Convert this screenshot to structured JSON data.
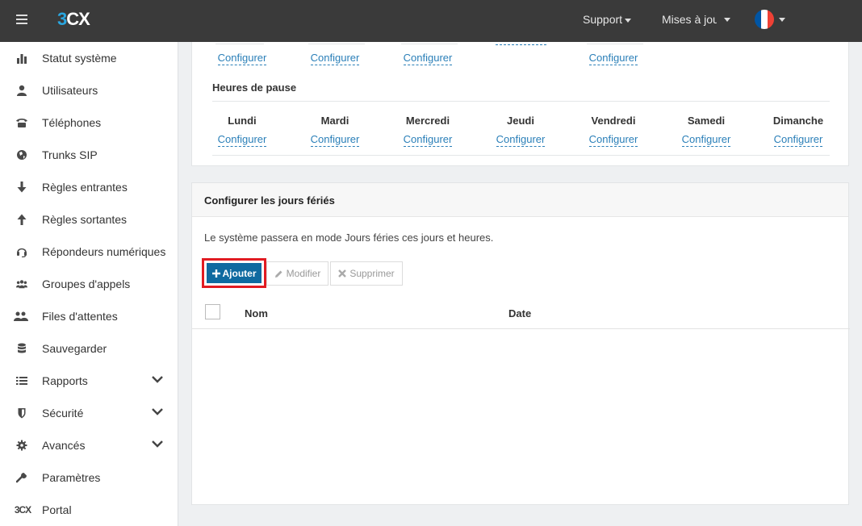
{
  "header": {
    "logo_3": "3",
    "logo_cx": "CX",
    "support": "Support",
    "updates": "Mises à jour",
    "flag_colors": [
      "#0055a4",
      "#ffffff",
      "#ef4135"
    ]
  },
  "sidebar": {
    "items": [
      {
        "label": "Statut système",
        "icon": "bar-chart-icon"
      },
      {
        "label": "Utilisateurs",
        "icon": "user-icon"
      },
      {
        "label": "Téléphones",
        "icon": "phone-icon"
      },
      {
        "label": "Trunks SIP",
        "icon": "globe-icon"
      },
      {
        "label": "Règles entrantes",
        "icon": "arrow-down-icon"
      },
      {
        "label": "Règles sortantes",
        "icon": "arrow-up-icon"
      },
      {
        "label": "Répondeurs numériques",
        "icon": "headset-icon"
      },
      {
        "label": "Groupes d'appels",
        "icon": "group-icon"
      },
      {
        "label": "Files d'attentes",
        "icon": "queue-icon"
      },
      {
        "label": "Sauvegarder",
        "icon": "database-icon"
      },
      {
        "label": "Rapports",
        "icon": "list-icon"
      },
      {
        "label": "Sécurité",
        "icon": "shield-icon"
      },
      {
        "label": "Avancés",
        "icon": "gear-icon"
      },
      {
        "label": "Paramètres",
        "icon": "wrench-icon"
      },
      {
        "label": "Portal",
        "icon": "3cx-logo-icon"
      }
    ],
    "portal_logo": "3CX"
  },
  "office_hours": {
    "top_configure_labels": [
      "Configurer",
      "Configurer",
      "Configurer",
      "Configurer"
    ],
    "break_title": "Heures de pause",
    "days": [
      "Lundi",
      "Mardi",
      "Mercredi",
      "Jeudi",
      "Vendredi",
      "Samedi",
      "Dimanche"
    ],
    "configure_label": "Configurer"
  },
  "holidays": {
    "title": "Configurer les jours fériés",
    "description": "Le système passera en mode Jours féries ces jours et heures.",
    "add_label": "Ajouter",
    "edit_label": "Modifier",
    "delete_label": "Supprimer",
    "col_name": "Nom",
    "col_date": "Date"
  }
}
